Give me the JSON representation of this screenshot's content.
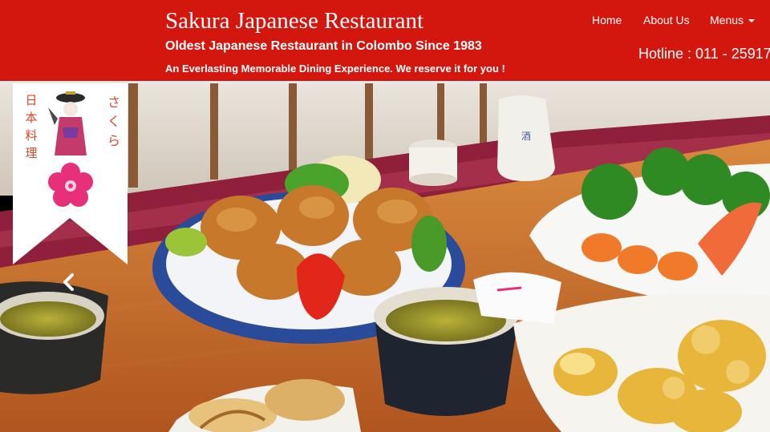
{
  "header": {
    "title": "Sakura Japanese Restaurant",
    "subtitle": "Oldest Japanese Restaurant in Colombo Since 1983",
    "tagline": "An Everlasting Memorable Dining Experience. We reserve it for you !",
    "hotline": "Hotline : 011 - 25917"
  },
  "nav": {
    "home": "Home",
    "about": "About Us",
    "menus": "Menus"
  },
  "logo": {
    "left_glyphs": "日本料理",
    "right_glyphs": "さくら",
    "icon": "geisha-sakura-logo-icon"
  },
  "carousel": {
    "prev_icon": "chevron-left-icon"
  },
  "colors": {
    "header_bg": "#d4170e",
    "sakura_pink": "#e8307a",
    "logo_text": "#d84a2a"
  }
}
